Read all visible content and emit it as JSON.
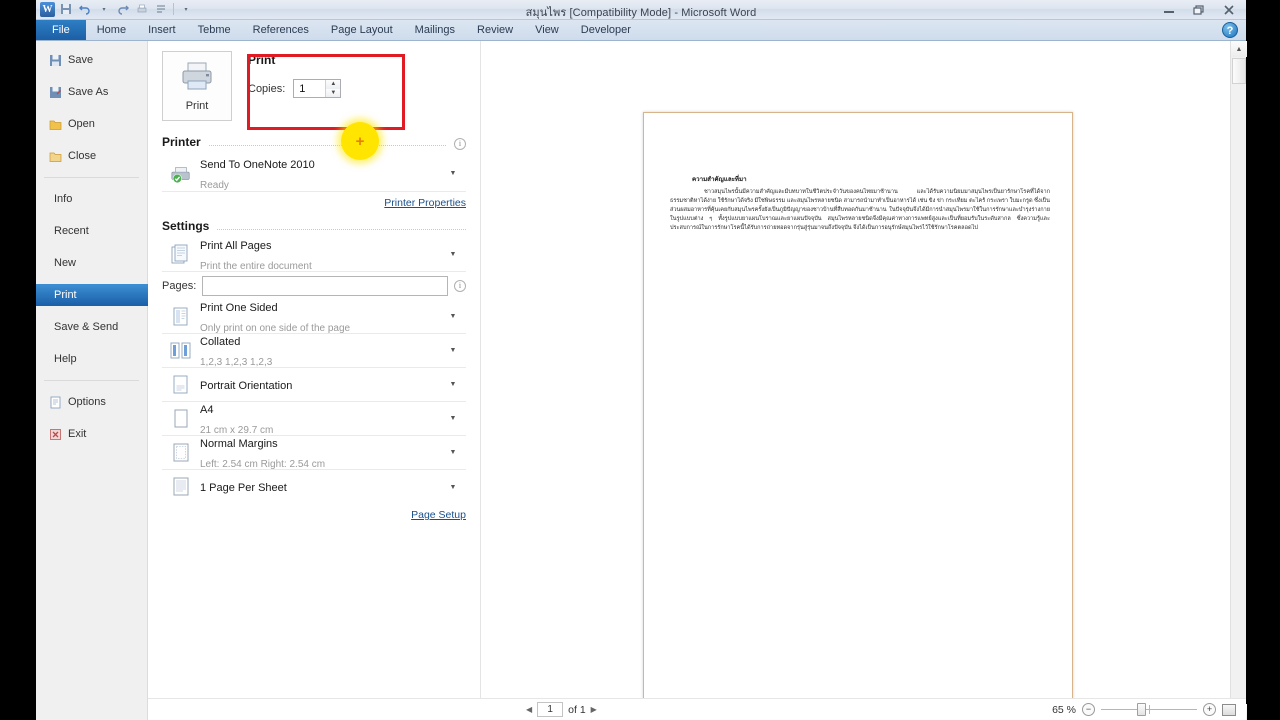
{
  "window": {
    "title": "สมุนไพร [Compatibility Mode]  -  Microsoft Word",
    "qat": {
      "app_logo": "word-logo",
      "save": "save-icon",
      "undo": "undo-icon",
      "redo": "redo-icon",
      "print_preview": "print-preview-icon",
      "customize": "customize-qat-icon"
    },
    "controls": {
      "minimize": "minimize-icon",
      "restore": "restore-icon",
      "close": "close-icon",
      "help": "?"
    }
  },
  "ribbon": {
    "tabs": [
      {
        "label": "File",
        "active": true
      },
      {
        "label": "Home",
        "active": false
      },
      {
        "label": "Insert",
        "active": false
      },
      {
        "label": "Tebme",
        "active": false
      },
      {
        "label": "References",
        "active": false
      },
      {
        "label": "Page Layout",
        "active": false
      },
      {
        "label": "Mailings",
        "active": false
      },
      {
        "label": "Review",
        "active": false
      },
      {
        "label": "View",
        "active": false
      },
      {
        "label": "Developer",
        "active": false
      }
    ]
  },
  "sidebar": {
    "items": [
      {
        "label": "Save",
        "icon": "save-icon",
        "active": false
      },
      {
        "label": "Save As",
        "icon": "save-as-icon",
        "active": false
      },
      {
        "label": "Open",
        "icon": "open-icon",
        "active": false
      },
      {
        "label": "Close",
        "icon": "close-doc-icon",
        "active": false
      },
      {
        "label": "Info",
        "icon": "",
        "active": false
      },
      {
        "label": "Recent",
        "icon": "",
        "active": false
      },
      {
        "label": "New",
        "icon": "",
        "active": false
      },
      {
        "label": "Print",
        "icon": "",
        "active": true
      },
      {
        "label": "Save & Send",
        "icon": "",
        "active": false
      },
      {
        "label": "Help",
        "icon": "",
        "active": false
      },
      {
        "label": "Options",
        "icon": "options-icon",
        "active": false
      },
      {
        "label": "Exit",
        "icon": "exit-icon",
        "active": false
      }
    ]
  },
  "print": {
    "button_label": "Print",
    "heading": "Print",
    "copies_label": "Copies:",
    "copies_value": "1",
    "printer_section_title": "Printer",
    "printer": {
      "name": "Send To OneNote 2010",
      "status": "Ready"
    },
    "printer_properties_link": "Printer Properties",
    "settings_section_title": "Settings",
    "settings": [
      {
        "main": "Print All Pages",
        "sub": "Print the entire document",
        "icon": "print-all-pages-icon"
      },
      {
        "main": "Print One Sided",
        "sub": "Only print on one side of the page",
        "icon": "one-sided-icon"
      },
      {
        "main": "Collated",
        "sub": "1,2,3   1,2,3   1,2,3",
        "icon": "collated-icon"
      },
      {
        "main": "Portrait Orientation",
        "sub": "",
        "icon": "orientation-icon"
      },
      {
        "main": "A4",
        "sub": "21 cm x 29.7 cm",
        "icon": "paper-size-icon"
      },
      {
        "main": "Normal Margins",
        "sub": "Left:  2.54 cm    Right:  2.54 cm",
        "icon": "margins-icon"
      },
      {
        "main": "1 Page Per Sheet",
        "sub": "",
        "icon": "pages-per-sheet-icon"
      }
    ],
    "pages_label": "Pages:",
    "pages_value": "",
    "page_setup_link": "Page Setup"
  },
  "preview": {
    "doc_heading": "ความสำคัญและที่มา",
    "doc_body": "ชาวสมุนไพรนั้นมีความสำคัญและมีบทบาทในชีวิตประจำวันของคนไทยมาช้านาน และได้รับความนิยมมาสมุนไพรเป็นยารักษาโรคที่ได้จากธรรมชาติหาได้ง่าย ใช้รักษาได้จริง มีใช่พิษธรรม และสมุนไพรหลายชนิด สามารถนำมาทำเป็นอาหารได้ เช่น ขิง ข่า กระเทียม ตะไคร้ กระเพรา ใบมะกรูด ซึ่งเป็นส่วนผสมอาหารที่คุ้นเคยกับสมุนไพรครั้งยังเป็นภูมิปัญญาของชาวบ้านที่สืบทอดกันมาช้านาน ในปัจจุบันจึงได้มีการนำสมุนไพรมาใช้ในการรักษาและบำรุงร่างกายในรูปแบบต่าง ๆ ทั้งรูปแบบยาแผนโบราณและยาแผนปัจจุบัน สมุนไพรหลายชนิดจึงมีคุณค่าทางการแพทย์สูงและเป็นที่ยอมรับในระดับสากล ซึ่งความรู้และประสบการณ์ในการรักษาโรคนี้ได้รับการถ่ายทอดจากรุ่นสู่รุ่นมาจนถึงปัจจุบัน จึงได้เป็นการอนุรักษ์สมุนไพรไว้ใช้รักษาโรคตลอดไป"
  },
  "status": {
    "prev_arrow": "prev-page-icon",
    "page_current": "1",
    "page_total": "of 1",
    "next_arrow": "next-page-icon",
    "zoom_percent": "65 %",
    "zoom_out": "−",
    "zoom_in": "+",
    "zoom_to_page": "zoom-to-page-icon"
  },
  "annotations": {
    "highlight_box_color": "#e01b24",
    "click_marker_color": "#ffe500",
    "click_marker_glyph": "+"
  }
}
